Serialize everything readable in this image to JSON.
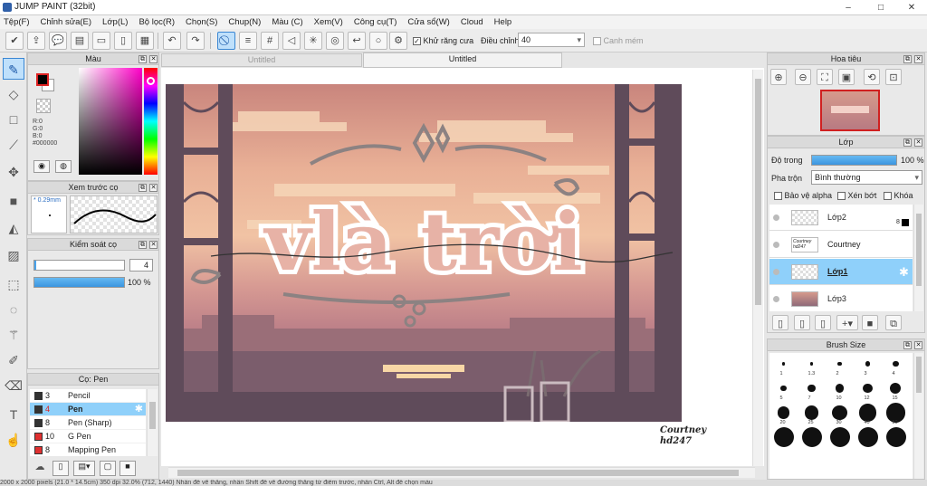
{
  "window": {
    "title": "JUMP PAINT (32bit)",
    "minimize": "–",
    "maximize": "□",
    "close": "✕"
  },
  "menu": [
    "Tệp(F)",
    "Chỉnh sửa(E)",
    "Lớp(L)",
    "Bộ lọc(R)",
    "Chọn(S)",
    "Chup(N)",
    "Màu (C)",
    "Xem(V)",
    "Công cụ(T)",
    "Cửa sổ(W)",
    "Cloud",
    "Help"
  ],
  "toolbar": {
    "antialias_label": "Khử răng cưa",
    "antialias_checked": true,
    "adjust_label": "Điều chỉnh",
    "adjust_value": "40",
    "snap_label": "Canh mém",
    "snap_checked": false
  },
  "tabs": [
    "Untitled",
    "Untitled"
  ],
  "color_panel": {
    "title": "Màu",
    "r": "R:0",
    "g": "G:0",
    "b": "B:0",
    "hex": "#000000",
    "primary": "#000000",
    "secondary": "#ffffff"
  },
  "brush_preview": {
    "title": "Xem trước cọ",
    "size": "* 0.29mm"
  },
  "brush_control": {
    "title": "Kiểm soát cọ",
    "size_value": "4",
    "opacity_value": "100 %",
    "opacity": 1.0
  },
  "brush_list": {
    "title": "Cọ: Pen",
    "items": [
      {
        "num": "3",
        "name": "Pencil",
        "swatch": "#333333",
        "selected": false
      },
      {
        "num": "4",
        "name": "Pen",
        "swatch": "#333333",
        "selected": true
      },
      {
        "num": "8",
        "name": "Pen (Sharp)",
        "swatch": "#333333",
        "selected": false
      },
      {
        "num": "10",
        "name": "G Pen",
        "swatch": "#e03030",
        "selected": false
      },
      {
        "num": "8",
        "name": "Mapping Pen",
        "swatch": "#e03030",
        "selected": false
      }
    ]
  },
  "navigator": {
    "title": "Hoa tiêu"
  },
  "layers": {
    "title": "Lớp",
    "opacity_label": "Độ trong",
    "opacity_value": "100 %",
    "blend_label": "Pha trộn",
    "blend_value": "Bình thường",
    "protect_alpha": "Bảo vệ alpha",
    "clip": "Xén bớt",
    "lock": "Khóa",
    "items": [
      {
        "name": "Lớp2",
        "selected": false,
        "badge": "8"
      },
      {
        "name": "Courtney",
        "selected": false,
        "badge": ""
      },
      {
        "name": "Lớp1",
        "selected": true,
        "badge": ""
      },
      {
        "name": "Lớp3",
        "selected": false,
        "badge": ""
      }
    ]
  },
  "brush_size": {
    "title": "Brush Size",
    "labels": [
      "1",
      "1.3",
      "2",
      "3",
      "4",
      "5",
      "7",
      "10",
      "12",
      "15",
      "20",
      "25",
      "30",
      "40",
      "50"
    ]
  },
  "artwork": {
    "title_text": "vlà trời",
    "signature_line1": "Courtney",
    "signature_line2": "hd247"
  },
  "status": "2000 x 2000 pixels (21.0 * 14.5cm)  350 dpi  32.0%  (712, 1440)  Nhấn để vẽ thẳng, nhấn Shift để vẽ đường thẳng từ điểm trước, nhấn Ctrl, Alt để chọn màu"
}
